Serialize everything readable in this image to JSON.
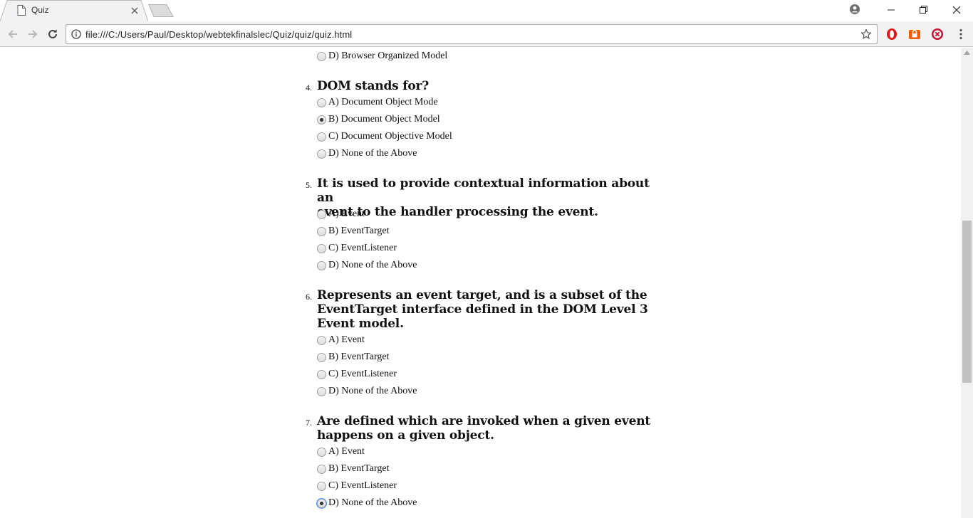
{
  "browser": {
    "tab_title": "Quiz",
    "url": "file:///C:/Users/Paul/Desktop/webtekfinalslec/Quiz/quiz/quiz.html",
    "icons": [
      "page-icon",
      "close-icon",
      "profile-icon",
      "minimize-icon",
      "restore-icon",
      "window-close-icon",
      "back-icon",
      "forward-icon",
      "reload-icon",
      "info-icon",
      "star-icon",
      "opera-extension-icon",
      "lock-extension-icon",
      "blocker-extension-icon",
      "menu-icon"
    ]
  },
  "quiz": {
    "prev_option": {
      "label": "D) Browser Organized Model"
    },
    "questions": [
      {
        "number": "4.",
        "lines": [
          "DOM stands for?"
        ],
        "options": [
          {
            "label": "A) Document Object Mode",
            "checked": false
          },
          {
            "label": "B) Document Object Model",
            "checked": true
          },
          {
            "label": "C) Document Objective Model",
            "checked": false
          },
          {
            "label": "D) None of the Above",
            "checked": false
          }
        ]
      },
      {
        "number": "5.",
        "lines": [
          "It is used to provide contextual information about an",
          "event to the handler processing the event."
        ],
        "options": [
          {
            "label": "A) Event",
            "checked": false
          },
          {
            "label": "B) EventTarget",
            "checked": false
          },
          {
            "label": "C) EventListener",
            "checked": false
          },
          {
            "label": "D) None of the Above",
            "checked": false
          }
        ]
      },
      {
        "number": "6.",
        "lines": [
          "Represents an event target, and is a subset of the",
          "EventTarget interface defined in the DOM Level 3",
          "Event model."
        ],
        "options": [
          {
            "label": "A) Event",
            "checked": false
          },
          {
            "label": "B) EventTarget",
            "checked": false
          },
          {
            "label": "C) EventListener",
            "checked": false
          },
          {
            "label": "D) None of the Above",
            "checked": false
          }
        ]
      },
      {
        "number": "7.",
        "lines": [
          "Are defined which are invoked when a given event",
          "happens on a given object."
        ],
        "options": [
          {
            "label": "A) Event",
            "checked": false
          },
          {
            "label": "B) EventTarget",
            "checked": false
          },
          {
            "label": "C) EventListener",
            "checked": false
          },
          {
            "label": "D) None of the Above",
            "checked": true
          }
        ]
      }
    ]
  }
}
